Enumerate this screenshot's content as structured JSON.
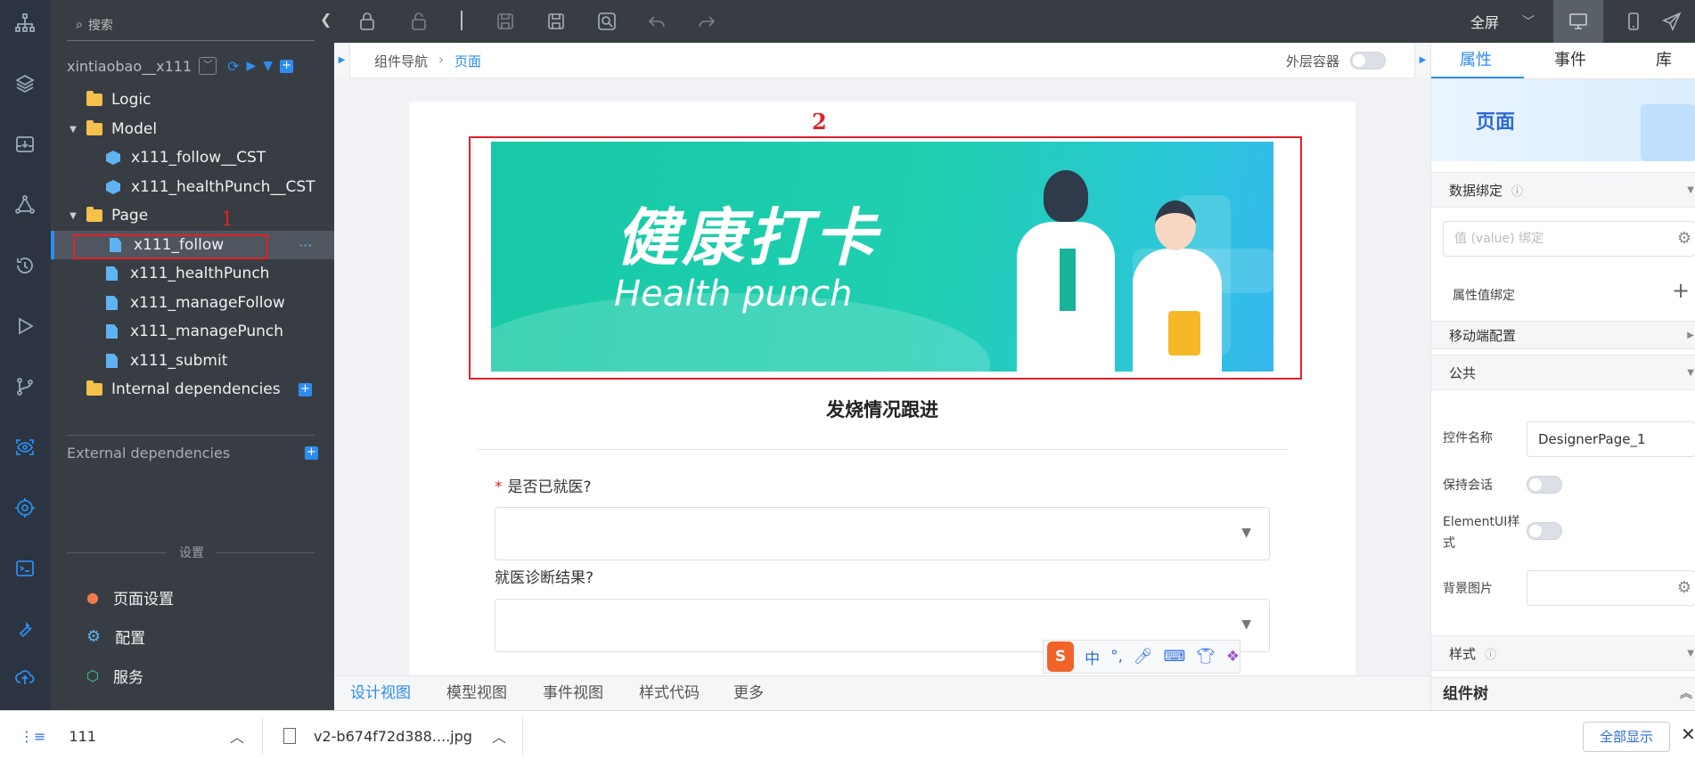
{
  "tree": {
    "search_placeholder": "搜索",
    "project": "xintiaobao__x111",
    "items": [
      {
        "label": "Logic",
        "type": "folder"
      },
      {
        "label": "Model",
        "type": "folder"
      },
      {
        "label": "x111_follow__CST",
        "type": "model"
      },
      {
        "label": "x111_healthPunch__CST",
        "type": "model"
      },
      {
        "label": "Page",
        "type": "folder"
      },
      {
        "label": "x111_follow",
        "type": "page"
      },
      {
        "label": "x111_healthPunch",
        "type": "page"
      },
      {
        "label": "x111_manageFollow",
        "type": "page"
      },
      {
        "label": "x111_managePunch",
        "type": "page"
      },
      {
        "label": "x111_submit",
        "type": "page"
      },
      {
        "label": "Internal dependencies",
        "type": "folder"
      }
    ],
    "external_label": "External dependencies",
    "more_dots": "···",
    "settings_title": "设置",
    "settings": [
      "页面设置",
      "配置",
      "服务"
    ]
  },
  "annotations": {
    "one": "1",
    "two": "2"
  },
  "toolbar": {
    "fullscreen": "全屏"
  },
  "breadcrumb": {
    "nav": "组件导航",
    "current": "页面",
    "outer_container": "外层容器"
  },
  "banner": {
    "title_cn": "健康打卡",
    "title_en": "Health punch"
  },
  "form": {
    "title": "发烧情况跟进",
    "required_mark": "*",
    "q1": "是否已就医?",
    "q2": "就医诊断结果?"
  },
  "ime": {
    "label": "中"
  },
  "right": {
    "tabs": [
      "属性",
      "事件",
      "库"
    ],
    "header": "页面",
    "data_binding": "数据绑定",
    "value_placeholder": "值 (value) 绑定",
    "attr_binding": "属性值绑定",
    "mobile_config": "移动端配置",
    "public": "公共",
    "ctrl_name_label": "控件名称",
    "ctrl_name_value": "DesignerPage_1",
    "keep_session": "保持会话",
    "element_ui": "ElementUI样式",
    "bg_image": "背景图片",
    "style": "样式",
    "component_tree": "组件树"
  },
  "bottom_tabs": [
    "设计视图",
    "模型视图",
    "事件视图",
    "样式代码",
    "更多"
  ],
  "download": {
    "item1": "111",
    "item2": "v2-b674f72d388....jpg",
    "show_all": "全部显示"
  },
  "colors": {
    "accent": "#2d8cf0",
    "rail": "#2b3440",
    "tree": "#383d44",
    "annotation": "#e0222b",
    "banner": "#1ec9a8"
  }
}
